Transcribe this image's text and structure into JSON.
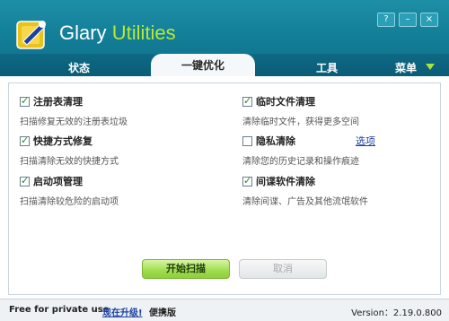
{
  "header": {
    "title_part1": "Glary",
    "title_part2": "Utilities",
    "window_buttons": [
      "?",
      "–",
      "×"
    ]
  },
  "nav": {
    "tabs": [
      {
        "label": "状态"
      },
      {
        "label": "一键优化"
      },
      {
        "label": "工具"
      },
      {
        "label": "菜单"
      }
    ]
  },
  "items": [
    {
      "title": "注册表清理",
      "desc": "扫描修复无效的注册表垃圾",
      "checked": true
    },
    {
      "title": "临时文件清理",
      "desc": "清除临时文件，获得更多空间",
      "checked": true
    },
    {
      "title": "快捷方式修复",
      "desc": "扫描清除无效的快捷方式",
      "checked": true
    },
    {
      "title": "隐私清除",
      "desc": "清除您的历史记录和操作痕迹",
      "checked": false
    },
    {
      "title": "启动项管理",
      "desc": "扫描清除较危险的启动项",
      "checked": true
    },
    {
      "title": "间谍软件清除",
      "desc": "清除间谍、广告及其他流氓软件",
      "checked": true
    }
  ],
  "options_link": "选项",
  "buttons": {
    "start": "开始扫描",
    "cancel": "取消"
  },
  "footer": {
    "free_text": "Free for private use",
    "upgrade": "现在升级!",
    "portable": "便携版",
    "version": "Version：2.19.0.800"
  },
  "colors": {
    "header": "#137f98",
    "accent_green": "#a8e63a",
    "link_blue": "#1b3fa0"
  }
}
